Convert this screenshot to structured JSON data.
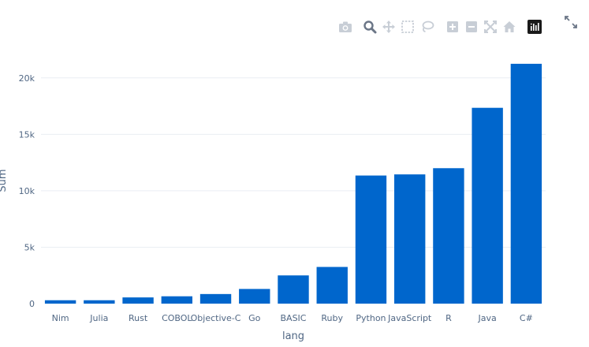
{
  "chart_data": {
    "type": "bar",
    "categories": [
      "Nim",
      "Julia",
      "Rust",
      "COBOL",
      "Objective-C",
      "Go",
      "BASIC",
      "Ruby",
      "Python",
      "JavaScript",
      "R",
      "Java",
      "C#"
    ],
    "values": [
      300,
      300,
      550,
      650,
      850,
      1300,
      2500,
      3250,
      11350,
      11450,
      12000,
      17350,
      21250
    ],
    "xlabel": "lang",
    "ylabel": "Sum",
    "ylim": [
      0,
      22500
    ],
    "yticks": [
      0,
      5000,
      10000,
      15000,
      20000
    ],
    "ytick_labels": [
      "0",
      "5k",
      "10k",
      "15k",
      "20k"
    ],
    "grid": true,
    "bar_color": "#0066cc"
  },
  "colors": {
    "grid": "#eaeef3",
    "text": "#506784",
    "icon": "#c8ced6",
    "icon_active": "#6b7687",
    "logo_bg": "#1a1a1a"
  },
  "modebar": {
    "icons": [
      "camera-icon",
      "zoom-icon",
      "pan-icon",
      "box-select-icon",
      "lasso-icon",
      "zoom-in-icon",
      "zoom-out-icon",
      "autoscale-icon",
      "reset-axes-icon",
      "plotly-logo-icon"
    ]
  },
  "fullscreen_icon": "expand-icon"
}
